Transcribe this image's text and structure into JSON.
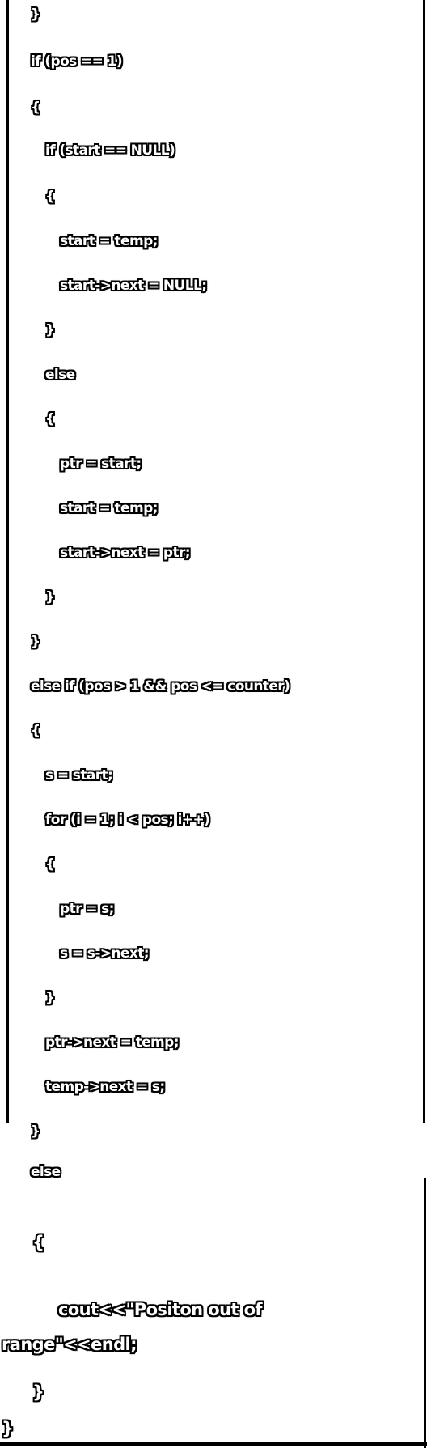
{
  "code": {
    "lines": [
      "}",
      "if (pos == 1)",
      "{",
      "if (start == NULL)",
      "{",
      "start = temp;",
      "start->next = NULL;",
      "}",
      "else",
      "{",
      "ptr = start;",
      "start = temp;",
      "start->next = ptr;",
      "}",
      "}",
      "else if (pos > 1 && pos <= counter)",
      "{",
      "s = start;",
      "for (i = 1; i < pos; i++)",
      "{",
      "ptr = s;",
      "s = s->next;",
      "}",
      "ptr->next = temp;",
      "temp->next = s;",
      "}",
      "else",
      "{",
      "cout<<\"Positon out of",
      "range\"<<endl;",
      "}",
      "}"
    ]
  }
}
